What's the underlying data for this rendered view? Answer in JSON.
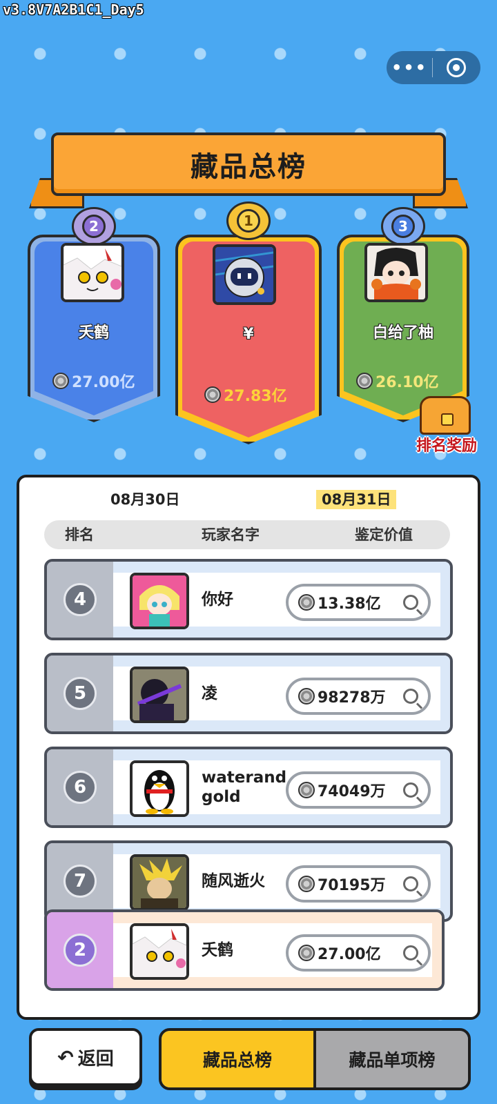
{
  "version": "v3.8V7A2B1C1_Day5",
  "capsule": {
    "more": "•••"
  },
  "title": "藏品总榜",
  "podium": {
    "first": {
      "rank": "1",
      "name": "¥",
      "value": "27.83亿",
      "value_color": "#fcd33a"
    },
    "second": {
      "rank": "2",
      "name": "夭鹤",
      "value": "27.00亿",
      "value_color": "#cfe0ff"
    },
    "third": {
      "rank": "3",
      "name": "白给了柚",
      "value": "26.10亿",
      "value_color": "#f3e67a"
    }
  },
  "reward_label": "排名奖励",
  "dates": {
    "d1": "08月30日",
    "d2": "08月31日",
    "selected": "08月31日"
  },
  "headers": {
    "rank": "排名",
    "name": "玩家名字",
    "value": "鉴定价值"
  },
  "rows": [
    {
      "rank": "4",
      "name": "你好",
      "value": "13.38亿"
    },
    {
      "rank": "5",
      "name": "凌",
      "value": "98278万"
    },
    {
      "rank": "6",
      "name": "waterand gold",
      "value": "74049万"
    },
    {
      "rank": "7",
      "name": "随风逝火",
      "value": "70195万"
    }
  ],
  "my_row": {
    "rank": "2",
    "name": "夭鹤",
    "value": "27.00亿"
  },
  "buttons": {
    "back": "返回",
    "tab_total": "藏品总榜",
    "tab_single": "藏品单项榜"
  },
  "colors": {
    "background": "#4aa8f2",
    "accent": "#fbc521",
    "reward": "#c5161b"
  }
}
